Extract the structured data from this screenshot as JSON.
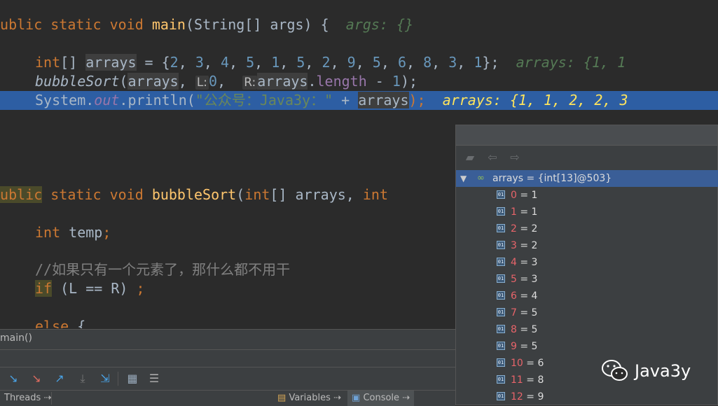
{
  "editor": {
    "main_sig": {
      "kw1": "public",
      "kw2": "static",
      "kw3": "void",
      "name": "main",
      "params": "(String[] args) {",
      "inline": "args: {}"
    },
    "decl": {
      "type": "int",
      "rest": "[] ",
      "var": "arrays",
      "assign": " = {",
      "values": [
        "2",
        "3",
        "4",
        "5",
        "1",
        "5",
        "2",
        "9",
        "5",
        "6",
        "8",
        "3",
        "1"
      ],
      "close": "};",
      "inline": "arrays: {1, 1"
    },
    "call": {
      "name": "bubbleSort",
      "open": "(",
      "arg1": "arrays",
      "sep": ", ",
      "hintL": "L:",
      "argL": "0",
      "sep2": ",  ",
      "hintR": "R:",
      "argR_var": "arrays",
      "argR_dot": ".",
      "argR_field": "length",
      "argR_rest": " - ",
      "argR_num": "1",
      "close": ");"
    },
    "println": {
      "cls": "System.",
      "field": "out",
      "method": ".println(",
      "string": "\"公众号：Java3y：\"",
      "plus": " + ",
      "var": "arrays",
      "close": ");",
      "inline": "arrays: {1, 1, 2, 2, 3"
    },
    "close_brace": "}",
    "bubble_sig": {
      "kw1": "public",
      "kw2": "static",
      "kw3": "void",
      "name": "bubbleSort",
      "open": "(",
      "t1": "int",
      "r1": "[] arrays, ",
      "t2": "int"
    },
    "temp": {
      "type": "int",
      "rest": " temp",
      "semi": ";"
    },
    "comment": "//如果只有一个元素了，那什么都不用干",
    "if_line": {
      "kw": "if",
      "rest": " (L == R) ",
      "semi": ";"
    },
    "else_line": {
      "kw": "else",
      "rest": " {"
    }
  },
  "frames": {
    "current": "main()"
  },
  "toolbar_icons": [
    "step-over-icon",
    "step-into-icon",
    "force-step-into-icon",
    "step-out-icon",
    "drop-frame-icon",
    "run-to-cursor-icon",
    "evaluate-expression-icon",
    "trace-icon"
  ],
  "tabs": {
    "threads": "Threads",
    "variables": "Variables",
    "console": "Console"
  },
  "variables": {
    "root": "arrays = {int[13]@503}",
    "items": [
      {
        "k": "0",
        "v": "1"
      },
      {
        "k": "1",
        "v": "1"
      },
      {
        "k": "2",
        "v": "2"
      },
      {
        "k": "3",
        "v": "2"
      },
      {
        "k": "4",
        "v": "3"
      },
      {
        "k": "5",
        "v": "3"
      },
      {
        "k": "6",
        "v": "4"
      },
      {
        "k": "7",
        "v": "5"
      },
      {
        "k": "8",
        "v": "5"
      },
      {
        "k": "9",
        "v": "5"
      },
      {
        "k": "10",
        "v": "6"
      },
      {
        "k": "11",
        "v": "8"
      },
      {
        "k": "12",
        "v": "9"
      }
    ]
  },
  "watermark": {
    "text": "Java3y"
  },
  "colors": {
    "editor_bg": "#2b2b2b",
    "keyword": "#cc7832",
    "number": "#6897bb",
    "highlight": "#2d5ea3",
    "panel_bg": "#3c3f41"
  }
}
